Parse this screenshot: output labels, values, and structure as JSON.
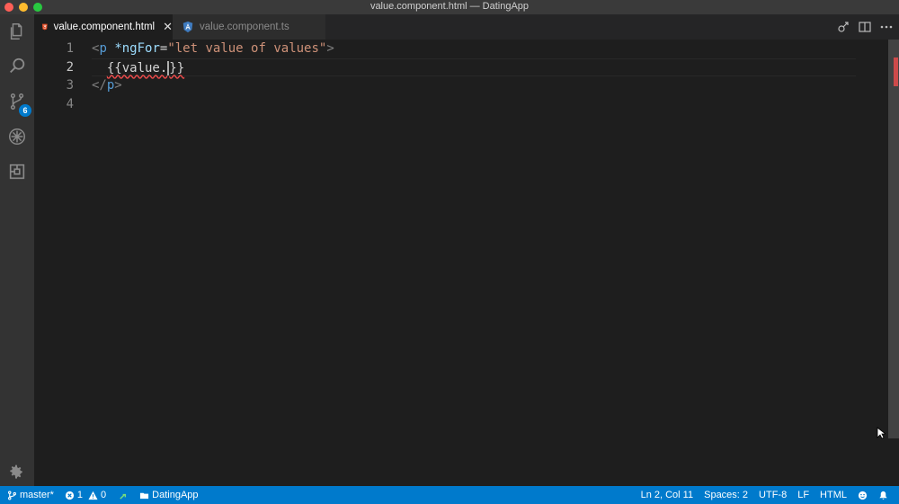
{
  "window": {
    "title": "value.component.html — DatingApp"
  },
  "activity_bar": {
    "items": [
      "explorer-icon",
      "search-icon",
      "source-control-icon",
      "debug-icon",
      "extensions-icon"
    ],
    "source_control_badge": "6"
  },
  "tabs": [
    {
      "label": "value.component.html",
      "active": true,
      "icon": "html5-icon"
    },
    {
      "label": "value.component.ts",
      "active": false,
      "icon": "angular-icon"
    }
  ],
  "editor": {
    "line_numbers": [
      "1",
      "2",
      "3",
      "4"
    ],
    "active_line": "2",
    "lines": {
      "l1": {
        "open": "<",
        "tag": "p",
        "space": " ",
        "attr": "*ngFor",
        "eq": "=",
        "str": "\"let value of values\"",
        "close": ">"
      },
      "l2": {
        "indent": "  ",
        "text": "{{value.",
        "after": "}}"
      },
      "l3": {
        "open": "</",
        "tag": "p",
        "close": ">"
      }
    }
  },
  "status_bar": {
    "branch": "master*",
    "errors": "1",
    "warnings": "0",
    "folder": "DatingApp",
    "cursor_position": "Ln 2, Col 11",
    "indentation": "Spaces: 2",
    "encoding": "UTF-8",
    "eol": "LF",
    "language": "HTML"
  },
  "colors": {
    "accent": "#007acc",
    "error": "#f14c4c",
    "editor_bg": "#1e1e1e"
  }
}
